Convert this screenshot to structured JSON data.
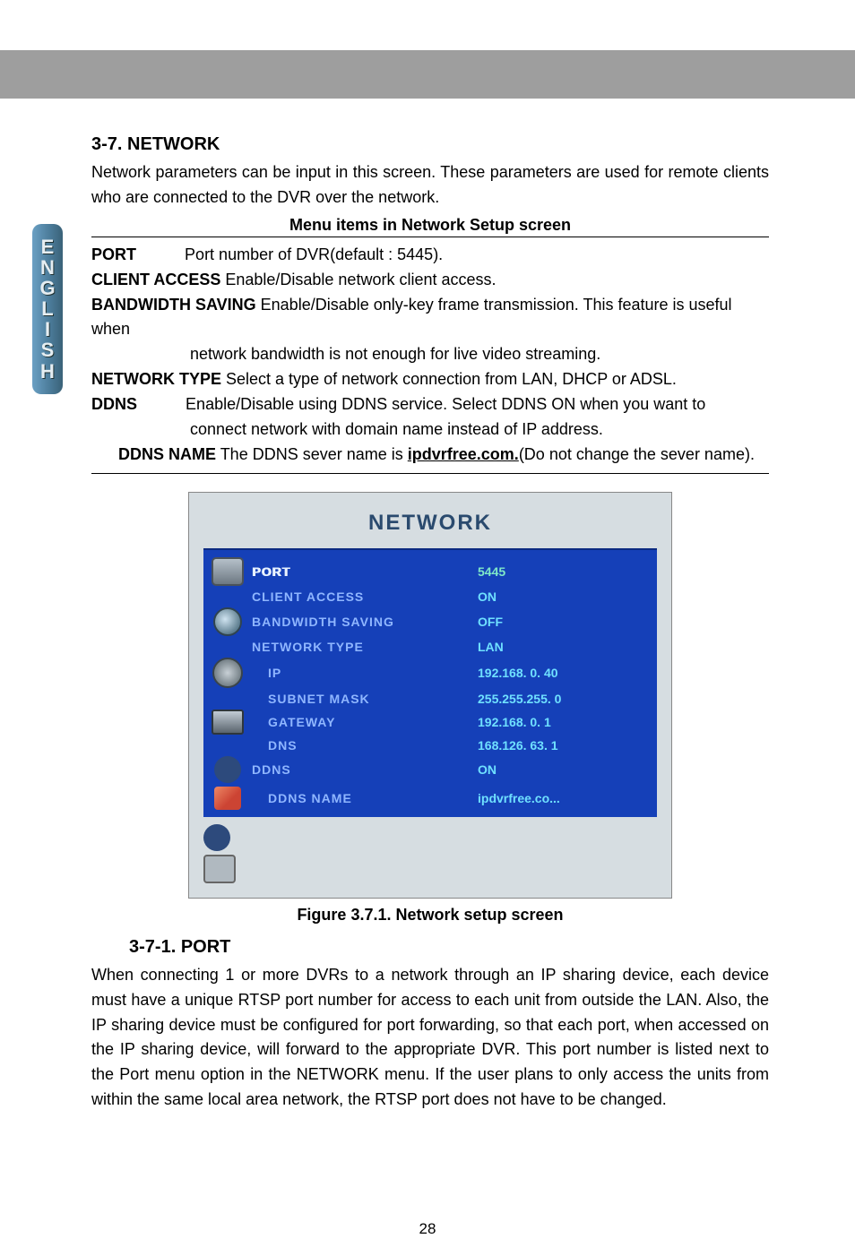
{
  "sidebar": {
    "letters": [
      "E",
      "N",
      "G",
      "L",
      "I",
      "S",
      "H"
    ]
  },
  "section": {
    "num": "3-7.",
    "title": "NETWORK"
  },
  "intro": "Network parameters can be input in this screen. These parameters are used for remote clients who are connected to the DVR over the network.",
  "tableTitle": "Menu items in Network Setup screen",
  "defs": {
    "port_k": "PORT",
    "port_v": "Port number of DVR(default : 5445).",
    "ca_k": "CLIENT ACCESS",
    "ca_v": " Enable/Disable network client access.",
    "bs_k": "BANDWIDTH SAVING",
    "bs_v": " Enable/Disable only-key frame transmission. This feature is useful when",
    "bs_v2": "network bandwidth is not enough for live video streaming.",
    "nt_k": "NETWORK TYPE",
    "nt_v": " Select a type of network connection from LAN, DHCP or ADSL.",
    "dd_k": "DDNS",
    "dd_v": "Enable/Disable using DDNS service. Select DDNS ON when you want to",
    "dd_v2": "connect network with domain name instead of IP address.",
    "dn_k": "DDNS NAME",
    "dn_v1": " The DDNS sever name is ",
    "dn_link": "ipdvrfree.com.",
    "dn_v2": "(Do not change the sever name)."
  },
  "panel": {
    "title": "NETWORK",
    "rows": [
      {
        "icon": "mon",
        "label": "PORT",
        "value": "5445",
        "hi": true
      },
      {
        "icon": "",
        "label": "CLIENT ACCESS",
        "value": "ON"
      },
      {
        "icon": "globe",
        "label": "BANDWIDTH SAVING",
        "value": "OFF"
      },
      {
        "icon": "",
        "label": "NETWORK TYPE",
        "value": "LAN"
      },
      {
        "icon": "gear",
        "label": "IP",
        "value": "192.168.  0. 40",
        "sub": true
      },
      {
        "icon": "",
        "label": "SUBNET MASK",
        "value": "255.255.255.  0",
        "sub": true
      },
      {
        "icon": "disp",
        "label": "GATEWAY",
        "value": "192.168.  0.  1",
        "sub": true
      },
      {
        "icon": "",
        "label": "DNS",
        "value": "168.126. 63.  1",
        "sub": true
      },
      {
        "icon": "recycle",
        "label": "DDNS",
        "value": "ON"
      },
      {
        "icon": "pen",
        "label": "DDNS NAME",
        "value": "ipdvrfree.co...",
        "sub": true
      }
    ]
  },
  "figcap": "Figure 3.7.1. Network setup screen",
  "sub": {
    "num": "3-7-1.",
    "title": "PORT"
  },
  "paragraph": "When connecting 1 or more DVRs to a network through an IP sharing device, each device must have a unique RTSP port number for access to each unit from outside the LAN. Also, the IP sharing device must be configured for port forwarding, so that each port, when accessed on the IP sharing device, will forward to the appropriate DVR. This port number is listed next to the Port menu option in the NETWORK menu. If the user plans to only access the units from within the same local area network, the RTSP port does not have to be changed.",
  "pagenum": "28"
}
